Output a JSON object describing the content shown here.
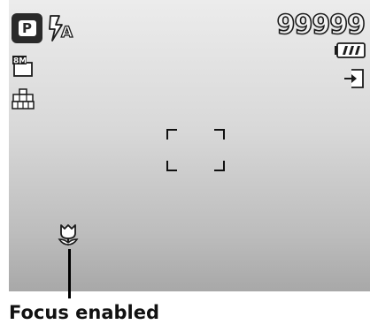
{
  "lcd": {
    "mode_label": "P",
    "flash_label": "A",
    "image_size_label": "8M",
    "shots_remaining": "99999"
  },
  "icons": {
    "mode": "program-mode-icon",
    "flash": "flash-auto-icon",
    "image_size": "image-size-8m-icon",
    "quality": "quality-icon",
    "battery": "battery-icon",
    "storage": "memory-card-icon",
    "macro": "macro-icon"
  },
  "callout": {
    "label": "Focus enabled"
  }
}
